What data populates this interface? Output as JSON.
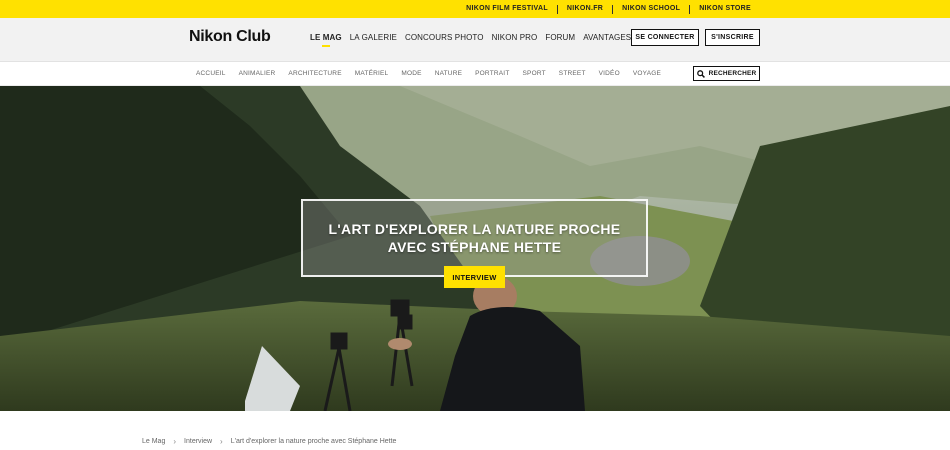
{
  "topbar": {
    "links": [
      "NIKON FILM FESTIVAL",
      "NIKON.FR",
      "NIKON SCHOOL",
      "NIKON STORE"
    ]
  },
  "header": {
    "logo": "Nikon Club",
    "nav": [
      "LE MAG",
      "LA GALERIE",
      "CONCOURS PHOTO",
      "NIKON PRO",
      "FORUM",
      "AVANTAGES"
    ],
    "active_nav": "LE MAG",
    "login_label": "SE CONNECTER",
    "signup_label": "S'INSCRIRE"
  },
  "categories": {
    "items": [
      "ACCUEIL",
      "ANIMALIER",
      "ARCHITECTURE",
      "MATÉRIEL",
      "MODE",
      "NATURE",
      "PORTRAIT",
      "SPORT",
      "STREET",
      "VIDÉO",
      "VOYAGE"
    ],
    "search_label": "RECHERCHER"
  },
  "hero": {
    "title_line1": "L'ART D'EXPLORER LA NATURE PROCHE",
    "title_line2": "AVEC STÉPHANE HETTE",
    "badge": "INTERVIEW"
  },
  "breadcrumb": {
    "items": [
      "Le Mag",
      "Interview",
      "L'art d'explorer la nature proche avec Stéphane Hette"
    ]
  },
  "colors": {
    "accent": "#ffe100",
    "header_bg": "#f2f2f2"
  }
}
